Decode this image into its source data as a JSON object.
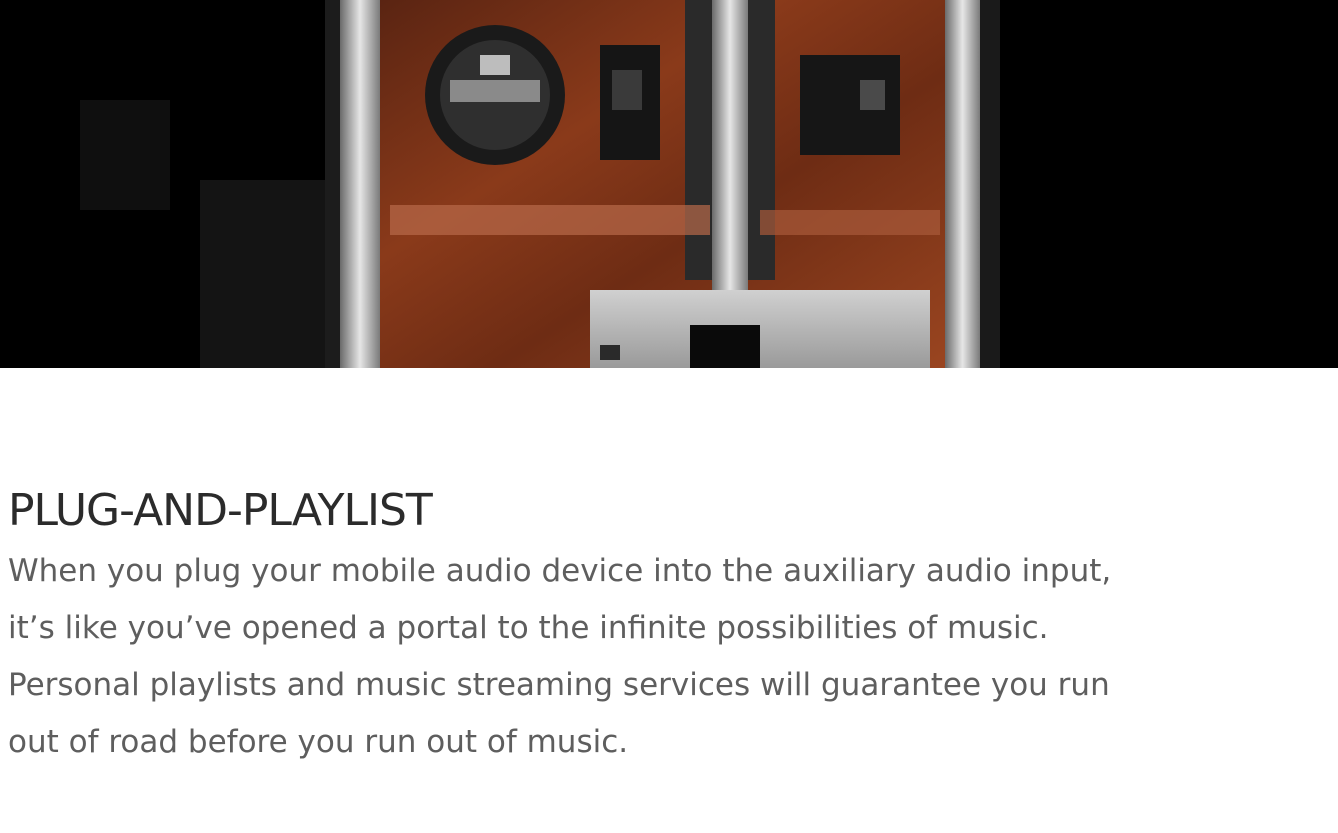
{
  "hero": {
    "image_icon": "car-console-aux-input-image"
  },
  "feature": {
    "title": "PLUG-AND-PLAYLIST",
    "body_lines": [
      "When you plug your mobile audio device into the auxiliary audio input,",
      "it’s like you’ve opened a portal to the infinite possibilities of music.",
      "Personal playlists and music streaming services will guarantee you run",
      "out of road before you run out of music."
    ]
  },
  "colors": {
    "title": "#2b2b2b",
    "body": "#5e5e5e",
    "hero_background": "#000000",
    "wood_panel": "#7a3318"
  }
}
